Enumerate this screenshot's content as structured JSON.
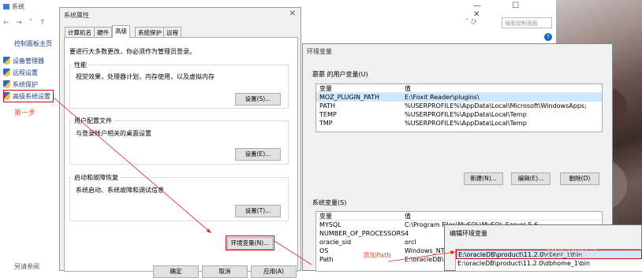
{
  "system_window": {
    "title": "系统",
    "controls": "—  ☐  ✕",
    "nav_arrows": "←  →  ˅ ↑",
    "addr_right": "˅  ひ",
    "search_placeholder": "搜索控制面板",
    "help": "?",
    "cp_home": "控制面板主页",
    "sidebar": [
      {
        "label": "设备管理器"
      },
      {
        "label": "远程设置"
      },
      {
        "label": "系统保护"
      },
      {
        "label": "高级系统设置"
      }
    ],
    "step1": "第一步",
    "see_also": "另请参阅"
  },
  "props": {
    "title": "系统属性",
    "close": "✕",
    "tabs": [
      "计算机名",
      "硬件",
      "高级",
      "系统保护",
      "远程"
    ],
    "admin_note": "要进行大多数更改，你必须作为管理员登录。",
    "perf": {
      "label": "性能",
      "desc": "视觉效果，处理器计划，内存使用，以及虚拟内存",
      "btn": "设置(S)..."
    },
    "profile": {
      "label": "用户配置文件",
      "desc": "与登录帐户相关的桌面设置",
      "btn": "设置(E)..."
    },
    "startup": {
      "label": "启动和故障恢复",
      "desc": "系统启动、系统故障和调试信息",
      "btn": "设置(T)..."
    },
    "env_btn": "环境变量(N)...",
    "bottom_buttons": [
      "确定",
      "取消",
      "应用(A)"
    ]
  },
  "env": {
    "title": "环境变量",
    "user_group": "慕慕 的用户变量(U)",
    "col_var": "变量",
    "col_val": "值",
    "user_vars": [
      {
        "name": "MOZ_PLUGIN_PATH",
        "value": "E:\\Foxit Reader\\plugins\\"
      },
      {
        "name": "PATH",
        "value": "%USERPROFILE%\\AppData\\Local\\Microsoft\\WindowsApps;"
      },
      {
        "name": "TEMP",
        "value": "%USERPROFILE%\\AppData\\Local\\Temp"
      },
      {
        "name": "TMP",
        "value": "%USERPROFILE%\\AppData\\Local\\Temp"
      }
    ],
    "user_buttons": [
      "新建(N)...",
      "编辑(E)...",
      "删除(D)"
    ],
    "sys_group": "系统变量(S)",
    "sys_vars": [
      {
        "name": "MYSQL",
        "value": "C:\\Program Files\\MySQL\\MySQL Server 5.6"
      },
      {
        "name": "NUMBER_OF_PROCESSORS",
        "value": "4"
      },
      {
        "name": "oracle_sid",
        "value": "orcl"
      },
      {
        "name": "OS",
        "value": "Windows_NT"
      },
      {
        "name": "Path",
        "value": "E:\\oracleDB\\pr"
      }
    ]
  },
  "edit": {
    "title": "编辑环境变量",
    "items": [
      "E:\\oracleDB\\product\\11.2.0\\client_1\\bin",
      "E:\\oracleDB\\product\\11.2.0\\dbhome_1\\bin"
    ]
  },
  "annotation_add_path": "添加Path",
  "watermark": "38230962",
  "colors": {
    "annotation": "#dd2222",
    "link": "#1a3e8c",
    "selected": "#cce8ff"
  }
}
